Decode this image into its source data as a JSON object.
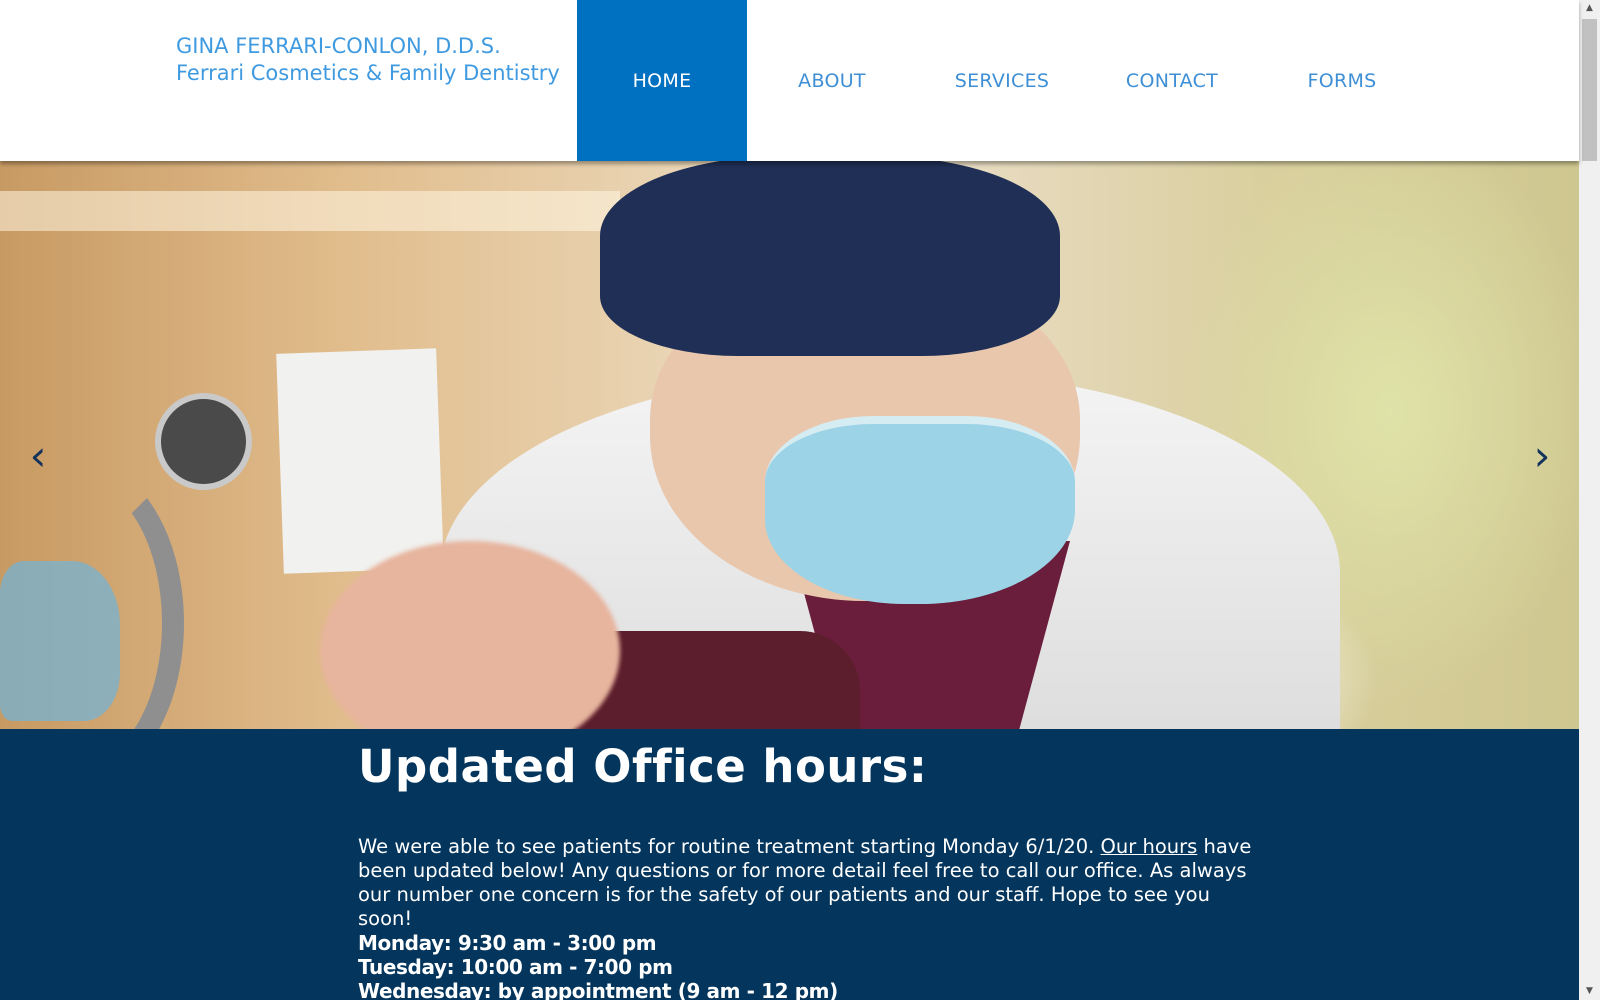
{
  "header": {
    "brand_line1": "GINA FERRARI-CONLON, D.D.S.",
    "brand_line2": "Ferrari Cosmetics & Family Dentistry",
    "nav": [
      {
        "label": "HOME",
        "active": true
      },
      {
        "label": "ABOUT",
        "active": false
      },
      {
        "label": "SERVICES",
        "active": false
      },
      {
        "label": "CONTACT",
        "active": false
      },
      {
        "label": "FORMS",
        "active": false
      }
    ]
  },
  "slider": {
    "prev_icon": "chevron-left-icon",
    "next_icon": "chevron-right-icon"
  },
  "content": {
    "heading": "Updated Office hours:",
    "para_before_link": "We were able to see patients for routine treatment starting Monday 6/1/20. ",
    "link_text": "Our hours",
    "para_after_link": " have been updated below! Any questions or for more detail feel free to call our office. As always our number one concern is for the safety of our patients and our staff. Hope to see you soon!",
    "hours": [
      "Monday: 9:30 am - 3:00 pm",
      "Tuesday: 10:00 am - 7:00 pm",
      "Wednesday: by appointment (9 am - 12 pm)"
    ]
  },
  "colors": {
    "brand_blue": "#3f9ae0",
    "nav_active_bg": "#0070c0",
    "content_bg": "#03355d"
  }
}
